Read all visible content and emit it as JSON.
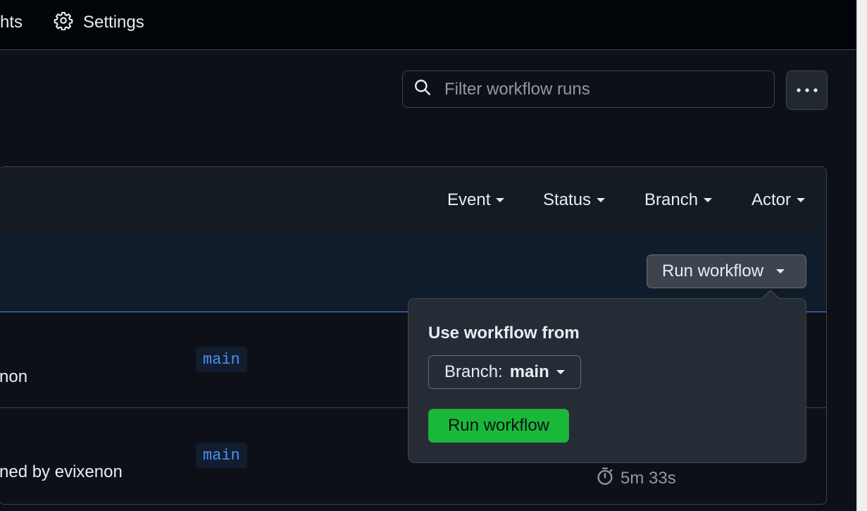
{
  "nav": {
    "partial_label": "hts",
    "settings_label": "Settings"
  },
  "search": {
    "placeholder": "Filter workflow runs",
    "value": ""
  },
  "filters": [
    "Event",
    "Status",
    "Branch",
    "Actor"
  ],
  "banner": {
    "run_workflow_label": "Run workflow"
  },
  "rows": [
    {
      "actor_text": "non",
      "branch": "main"
    },
    {
      "actor_text": "ned by evixenon",
      "branch": "main",
      "duration": "5m 33s"
    }
  ],
  "popover": {
    "title": "Use workflow from",
    "branch_prefix": "Branch:",
    "branch_value": "main",
    "run_button": "Run workflow"
  },
  "colors": {
    "accent_blue": "#4493f8",
    "run_green": "#1ab83a",
    "background": "#0d1117"
  },
  "icons": [
    "gear-icon",
    "search-icon",
    "kebab-icon",
    "caret-down-icon",
    "stopwatch-icon"
  ]
}
